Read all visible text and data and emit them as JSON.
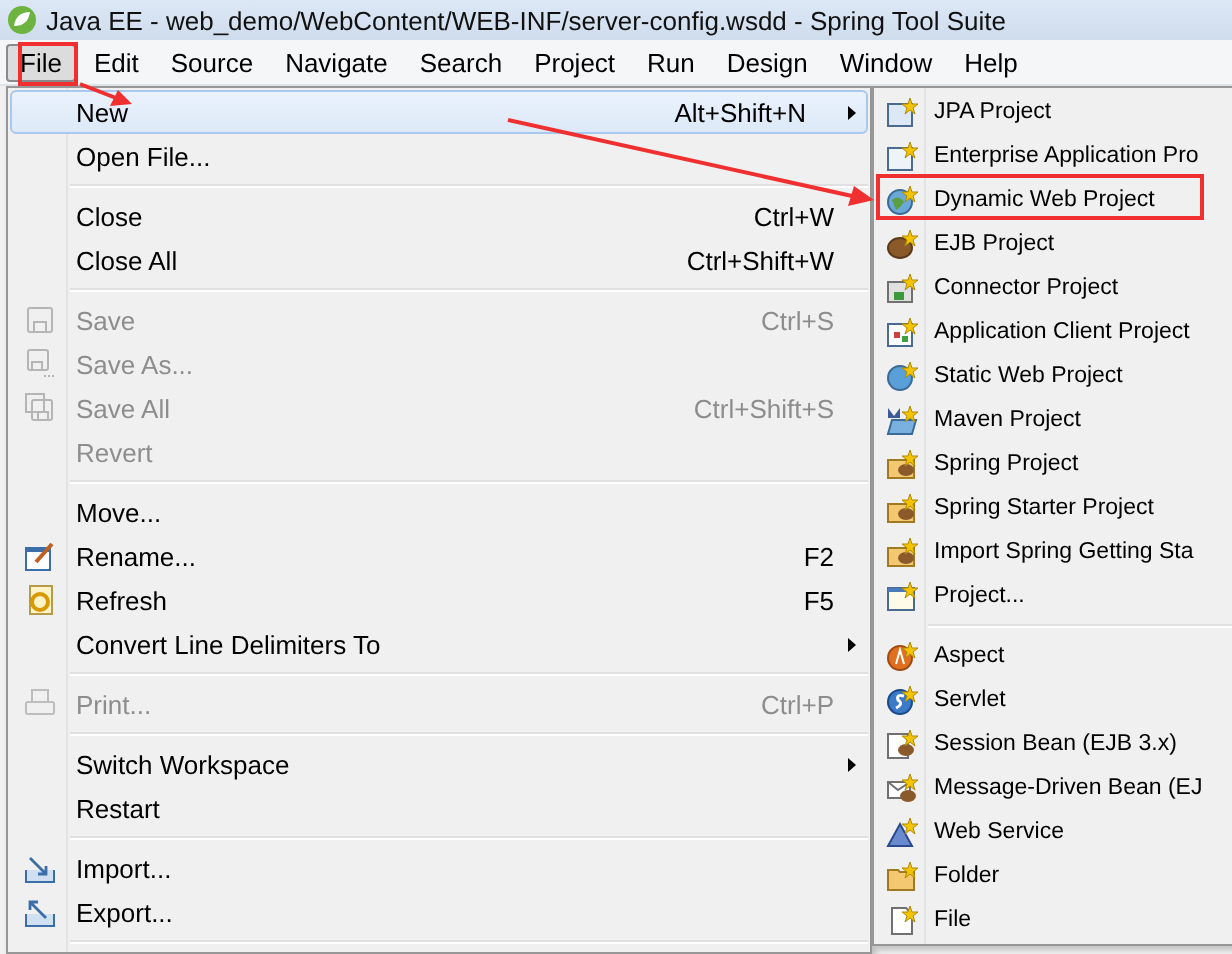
{
  "window": {
    "title": "Java EE - web_demo/WebContent/WEB-INF/server-config.wsdd - Spring Tool Suite"
  },
  "menubar": [
    {
      "label": "File",
      "selected": true
    },
    {
      "label": "Edit",
      "selected": false
    },
    {
      "label": "Source",
      "selected": false
    },
    {
      "label": "Navigate",
      "selected": false
    },
    {
      "label": "Search",
      "selected": false
    },
    {
      "label": "Project",
      "selected": false
    },
    {
      "label": "Run",
      "selected": false
    },
    {
      "label": "Design",
      "selected": false
    },
    {
      "label": "Window",
      "selected": false
    },
    {
      "label": "Help",
      "selected": false
    }
  ],
  "file_menu": [
    {
      "kind": "item",
      "label": "New",
      "shortcut": "Alt+Shift+N",
      "submenu": true,
      "disabled": false,
      "selected": true
    },
    {
      "kind": "item",
      "label": "Open File...",
      "disabled": false,
      "selected": false
    },
    {
      "kind": "separator"
    },
    {
      "kind": "item",
      "label": "Close",
      "shortcut": "Ctrl+W",
      "disabled": false,
      "selected": false
    },
    {
      "kind": "item",
      "label": "Close All",
      "shortcut": "Ctrl+Shift+W",
      "disabled": false,
      "selected": false
    },
    {
      "kind": "separator"
    },
    {
      "kind": "item",
      "label": "Save",
      "shortcut": "Ctrl+S",
      "disabled": true,
      "selected": false
    },
    {
      "kind": "item",
      "label": "Save As...",
      "disabled": true,
      "selected": false
    },
    {
      "kind": "item",
      "label": "Save All",
      "shortcut": "Ctrl+Shift+S",
      "disabled": true,
      "selected": false
    },
    {
      "kind": "item",
      "label": "Revert",
      "disabled": true,
      "selected": false
    },
    {
      "kind": "separator"
    },
    {
      "kind": "item",
      "label": "Move...",
      "disabled": false,
      "selected": false
    },
    {
      "kind": "item",
      "label": "Rename...",
      "shortcut": "F2",
      "disabled": false,
      "selected": false
    },
    {
      "kind": "item",
      "label": "Refresh",
      "shortcut": "F5",
      "disabled": false,
      "selected": false
    },
    {
      "kind": "item",
      "label": "Convert Line Delimiters To",
      "submenu": true,
      "disabled": false,
      "selected": false
    },
    {
      "kind": "separator"
    },
    {
      "kind": "item",
      "label": "Print...",
      "shortcut": "Ctrl+P",
      "disabled": true,
      "selected": false
    },
    {
      "kind": "separator"
    },
    {
      "kind": "item",
      "label": "Switch Workspace",
      "submenu": true,
      "disabled": false,
      "selected": false
    },
    {
      "kind": "item",
      "label": "Restart",
      "disabled": false,
      "selected": false
    },
    {
      "kind": "separator"
    },
    {
      "kind": "item",
      "label": "Import...",
      "disabled": false,
      "selected": false
    },
    {
      "kind": "item",
      "label": "Export...",
      "disabled": false,
      "selected": false
    },
    {
      "kind": "separator"
    }
  ],
  "new_submenu": [
    {
      "kind": "item",
      "label": "JPA Project",
      "selected": false
    },
    {
      "kind": "item",
      "label": "Enterprise Application Pro",
      "selected": false
    },
    {
      "kind": "item",
      "label": "Dynamic Web Project",
      "selected": false
    },
    {
      "kind": "item",
      "label": "EJB Project",
      "selected": false
    },
    {
      "kind": "item",
      "label": "Connector Project",
      "selected": false
    },
    {
      "kind": "item",
      "label": "Application Client Project",
      "selected": false
    },
    {
      "kind": "item",
      "label": "Static Web Project",
      "selected": false
    },
    {
      "kind": "item",
      "label": "Maven Project",
      "selected": false
    },
    {
      "kind": "item",
      "label": "Spring Project",
      "selected": false
    },
    {
      "kind": "item",
      "label": "Spring Starter Project",
      "selected": false
    },
    {
      "kind": "item",
      "label": "Import Spring Getting Sta",
      "selected": false
    },
    {
      "kind": "item",
      "label": "Project...",
      "selected": false
    },
    {
      "kind": "separator"
    },
    {
      "kind": "item",
      "label": "Aspect",
      "selected": false
    },
    {
      "kind": "item",
      "label": "Servlet",
      "selected": false
    },
    {
      "kind": "item",
      "label": "Session Bean (EJB 3.x)",
      "selected": false
    },
    {
      "kind": "item",
      "label": "Message-Driven Bean (EJ",
      "selected": false
    },
    {
      "kind": "item",
      "label": "Web Service",
      "selected": false
    },
    {
      "kind": "item",
      "label": "Folder",
      "selected": false
    },
    {
      "kind": "item",
      "label": "File",
      "selected": false
    }
  ]
}
